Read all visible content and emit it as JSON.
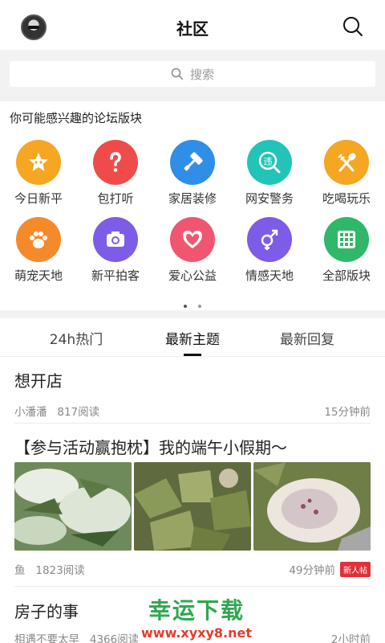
{
  "header": {
    "title": "社区",
    "avatar_icon": "avatar",
    "search_icon": "search-icon"
  },
  "search": {
    "placeholder": "搜索"
  },
  "section": {
    "title": "你可能感兴趣的论坛版块"
  },
  "forums": [
    {
      "label": "今日新平",
      "color": "#f5a623",
      "icon": "star-face-icon"
    },
    {
      "label": "包打听",
      "color": "#f04b4b",
      "icon": "question-icon"
    },
    {
      "label": "家居装修",
      "color": "#2f8ee8",
      "icon": "paint-roller-icon"
    },
    {
      "label": "网安警务",
      "color": "#22c4b7",
      "icon": "police-icon"
    },
    {
      "label": "吃喝玩乐",
      "color": "#f5a623",
      "icon": "fork-spoon-icon"
    },
    {
      "label": "萌宠天地",
      "color": "#f58a2b",
      "icon": "paw-icon"
    },
    {
      "label": "新平拍客",
      "color": "#7d5ce8",
      "icon": "camera-icon"
    },
    {
      "label": "爱心公益",
      "color": "#f0566f",
      "icon": "heart-icon"
    },
    {
      "label": "情感天地",
      "color": "#7d5ce8",
      "icon": "gender-icon"
    },
    {
      "label": "全部版块",
      "color": "#2fb86a",
      "icon": "grid-icon"
    }
  ],
  "pager": {
    "pages": 2,
    "active": 0
  },
  "tabs": [
    {
      "label": "24h热门",
      "active": false
    },
    {
      "label": "最新主题",
      "active": true
    },
    {
      "label": "最新回复",
      "active": false
    }
  ],
  "posts": [
    {
      "title": "想开店",
      "author": "小潘潘",
      "reads": "817阅读",
      "time": "15分钟前"
    },
    {
      "title": "【参与活动赢抱枕】我的端午小假期～",
      "author": "鱼",
      "reads": "1823阅读",
      "time": "49分钟前",
      "badge": "新人帖"
    },
    {
      "title": "房子的事",
      "author": "相遇不要太早",
      "reads": "4366阅读",
      "time": "2小时前"
    }
  ],
  "watermark": {
    "line1": "幸运下载",
    "line2": "www.xyxy8.net"
  },
  "colors": {
    "accent": "#111111",
    "background": "#f2f2f2",
    "badge": "#e0303a"
  }
}
